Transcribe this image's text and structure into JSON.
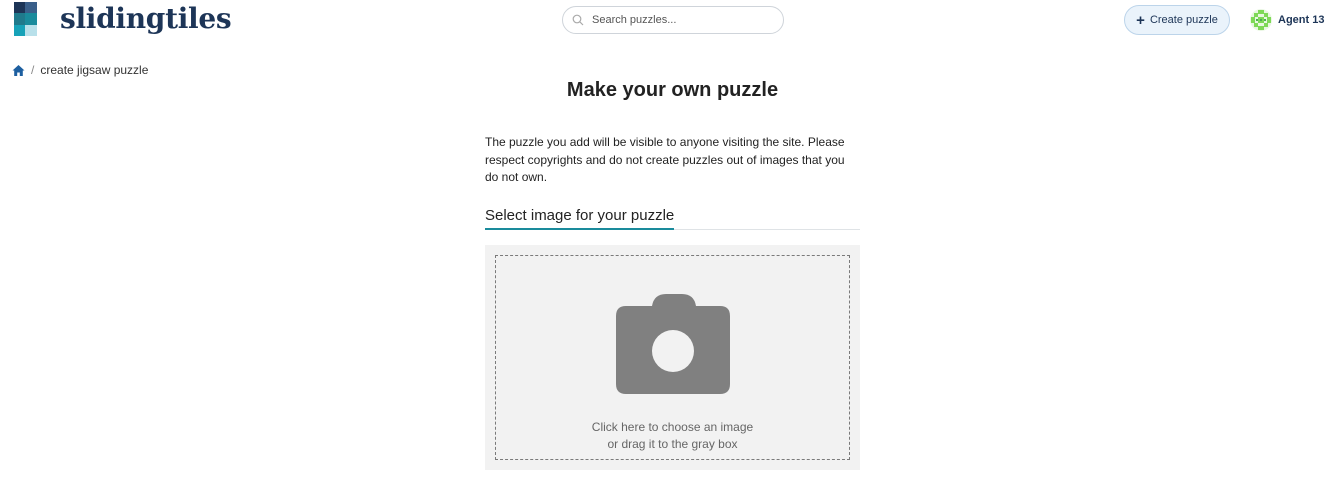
{
  "header": {
    "logo_text": "slidingtiles",
    "search_placeholder": "Search puzzles...",
    "create_label": "Create puzzle",
    "user_name": "Agent 13"
  },
  "breadcrumb": {
    "current": "create jigsaw puzzle"
  },
  "main": {
    "title": "Make your own puzzle",
    "notice": "The puzzle you add will be visible to anyone visiting the site. Please respect copyrights and do not create puzzles out of images that you do not own.",
    "section_label": "Select image for your puzzle",
    "upload_line1": "Click here to choose an image",
    "upload_line2": "or drag it to the gray box"
  },
  "colors": {
    "brand_navy": "#1d3557",
    "brand_teal": "#1a8b9c",
    "upload_bg": "#f2f2f2",
    "camera_gray": "#808080",
    "avatar_green": "#7ed957"
  },
  "icons": {
    "logo": "sliding-tiles-logo-icon",
    "search": "search-icon",
    "create": "plus-icon",
    "avatar": "user-avatar-icon",
    "home": "home-icon",
    "camera": "camera-icon"
  }
}
